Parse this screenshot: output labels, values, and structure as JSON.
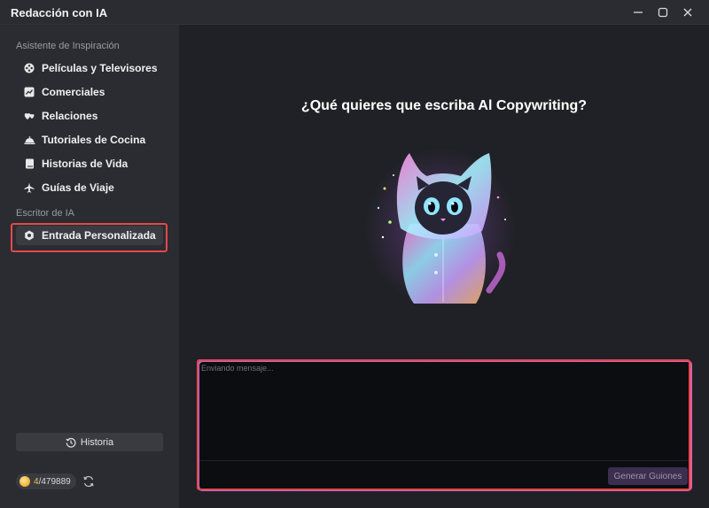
{
  "window": {
    "title": "Redacción con IA",
    "controls": [
      "minimize-icon",
      "maximize-icon",
      "close-icon"
    ]
  },
  "sidebar": {
    "inspiration_title": "Asistente de Inspiración",
    "inspiration_items": [
      {
        "label": "Películas y Televisores",
        "icon": "film-reel-icon"
      },
      {
        "label": "Comerciales",
        "icon": "trend-chart-icon"
      },
      {
        "label": "Relaciones",
        "icon": "hearts-icon"
      },
      {
        "label": "Tutoriales de Cocina",
        "icon": "cloche-icon"
      },
      {
        "label": "Historias de Vida",
        "icon": "book-icon"
      },
      {
        "label": "Guías de Viaje",
        "icon": "airplane-icon"
      }
    ],
    "writer_title": "Escritor de IA",
    "writer_items": [
      {
        "label": "Entrada Personalizada",
        "icon": "gear-icon",
        "active": true
      }
    ],
    "history_label": "Historia",
    "credits": {
      "used": "4",
      "total": "/479889"
    }
  },
  "main": {
    "heading": "¿Qué quieres que escriba Al Copywriting?",
    "mascot": "neon-cat-illustration",
    "input_placeholder": "Enviando mensaje...",
    "generate_label": "Generar Guiones"
  },
  "colors": {
    "highlight": "#e5484d",
    "input_border_gradient": [
      "#b26bd9",
      "#e85fa0"
    ],
    "credits_used": "#f0c14d"
  }
}
